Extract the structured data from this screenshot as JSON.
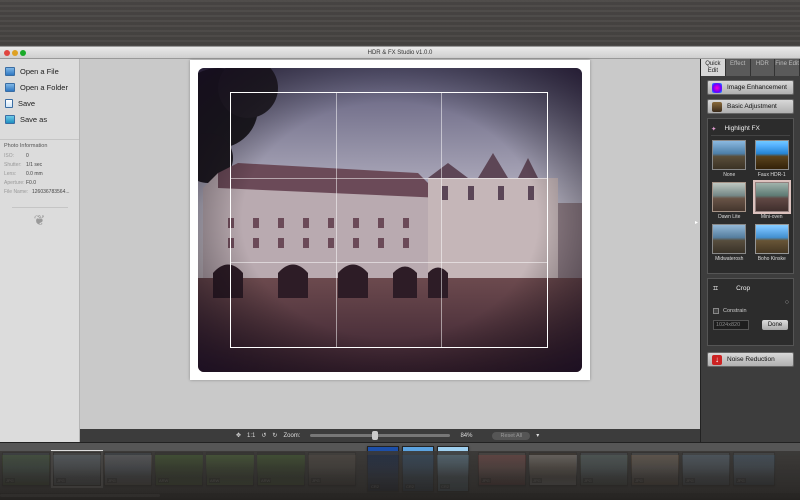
{
  "window": {
    "title": "HDR & FX Studio v1.0.0"
  },
  "sidebar": {
    "actions": [
      {
        "label": "Open a File",
        "icon": "image-file-icon"
      },
      {
        "label": "Open a Folder",
        "icon": "folder-icon"
      },
      {
        "label": "Save",
        "icon": "save-icon"
      },
      {
        "label": "Save as",
        "icon": "save-as-icon"
      }
    ],
    "photo_info": {
      "header": "Photo Information",
      "rows": [
        {
          "key": "ISO:",
          "value": "0"
        },
        {
          "key": "Shutter:",
          "value": "1/1 sec"
        },
        {
          "key": "Lens:",
          "value": "0.0 mm"
        },
        {
          "key": "Aperture:",
          "value": "F0.0"
        },
        {
          "key": "File Name:",
          "value": "126036783564..."
        }
      ]
    },
    "ornament": "❦"
  },
  "zoombar": {
    "one_to_one": "1:1",
    "zoom_label": "Zoom:",
    "zoom_value": "84%",
    "zoom_fraction": 0.84,
    "reset_label": "Reset All"
  },
  "right_panel": {
    "tabs": [
      {
        "label": "Quick Edit",
        "active": true
      },
      {
        "label": "Effect",
        "active": false
      },
      {
        "label": "HDR",
        "active": false
      },
      {
        "label": "Fine Edit",
        "active": false
      }
    ],
    "image_enhancement": "Image Enhancement",
    "basic_adjustment": "Basic Adjustment",
    "highlight_fx": {
      "title": "Highlight FX",
      "items": [
        {
          "label": "None",
          "selected": false
        },
        {
          "label": "Faux HDR-1",
          "selected": false
        },
        {
          "label": "Dawn Lite",
          "selected": false
        },
        {
          "label": "Mini-oven",
          "selected": true
        },
        {
          "label": "Midwaterosh",
          "selected": false
        },
        {
          "label": "Boho Kinske",
          "selected": false
        }
      ]
    },
    "crop": {
      "title": "Crop",
      "constrain_label": "Constrain",
      "size_placeholder": "1024x820",
      "done_label": "Done"
    },
    "noise_reduction": "Noise Reduction"
  },
  "filmstrip": {
    "items": [
      {
        "badge": "JPG",
        "top": "#6a8fb5",
        "bottom": "#4c6b2f"
      },
      {
        "badge": "JPG",
        "top": "#a9bdd0",
        "bottom": "#6d7c85",
        "selected": true
      },
      {
        "badge": "JPG",
        "top": "#6e9fd6",
        "bottom": "#8b7e73"
      },
      {
        "badge": "ARW",
        "top": "#2c3a22",
        "bottom": "#5c8a3a"
      },
      {
        "badge": "ARW",
        "top": "#2c3a22",
        "bottom": "#6c9a4a"
      },
      {
        "badge": "ARW",
        "top": "#2c3a22",
        "bottom": "#5c8a3a"
      },
      {
        "badge": "JPG",
        "top": "#8d8a85",
        "bottom": "#5a4f45"
      },
      {
        "badge": "CR2",
        "top": "#1d4fa8",
        "bottom": "#0b1c40"
      },
      {
        "badge": "CR2",
        "top": "#5ca3e0",
        "bottom": "#2d4a6e"
      },
      {
        "badge": "CR2",
        "top": "#9fd0f0",
        "bottom": "#6e9bb7"
      },
      {
        "badge": "JPG",
        "top": "#c8b9b0",
        "bottom": "#8e3b3b"
      },
      {
        "badge": "JPG",
        "top": "#6b4a2a",
        "bottom": "#c9c9c9"
      },
      {
        "badge": "JPG",
        "top": "#9cc6ec",
        "bottom": "#5f6e5f"
      },
      {
        "badge": "JPG",
        "top": "#b8c8d8",
        "bottom": "#8f6f4f"
      },
      {
        "badge": "JPG",
        "top": "#a7c7e7",
        "bottom": "#5b6f7f"
      },
      {
        "badge": "JPG",
        "top": "#9fc0e0",
        "bottom": "#3c5870"
      }
    ]
  }
}
